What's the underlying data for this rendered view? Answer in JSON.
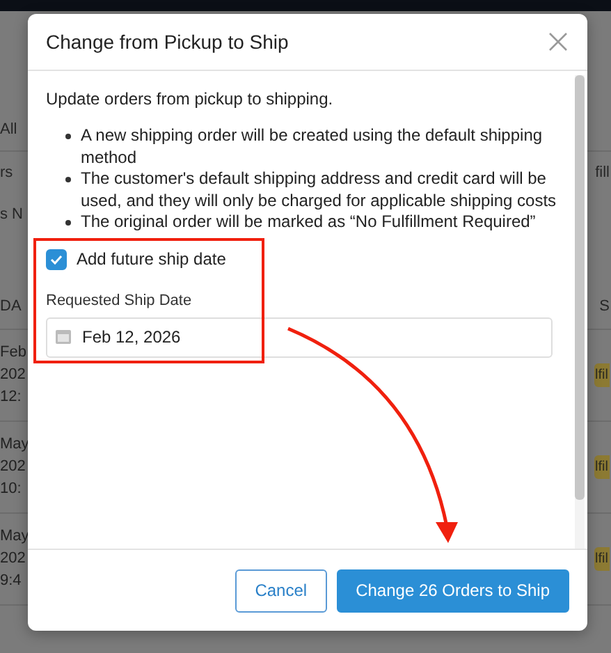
{
  "background": {
    "fragments": [
      {
        "left": "All"
      },
      {
        "left": "rs",
        "right": "fill"
      },
      {
        "left": "s N"
      }
    ],
    "table_header": {
      "left": "DA",
      "right": "S"
    },
    "rows": [
      {
        "lines": [
          "Feb",
          "202",
          "12:"
        ],
        "badge": "lfil"
      },
      {
        "lines": [
          "May",
          "202",
          "10:"
        ],
        "badge": "lfil"
      },
      {
        "lines": [
          "May",
          "202",
          "9:4"
        ],
        "badge": "lfil"
      }
    ]
  },
  "dialog": {
    "title": "Change from Pickup to Ship",
    "intro": "Update orders from pickup to shipping.",
    "bullets": [
      "A new shipping order will be created using the default shipping method",
      "The customer's default shipping address and credit card will be used, and they will only be charged for applicable shipping costs",
      "The original order will be marked as “No Fulfillment Required”"
    ],
    "checkbox": {
      "label": "Add future ship date",
      "checked": true
    },
    "date_field": {
      "label": "Requested Ship Date",
      "value": "Feb 12, 2026"
    },
    "buttons": [
      {
        "label": "Cancel",
        "kind": "secondary"
      },
      {
        "label": "Change 26 Orders to Ship",
        "kind": "primary"
      }
    ]
  }
}
